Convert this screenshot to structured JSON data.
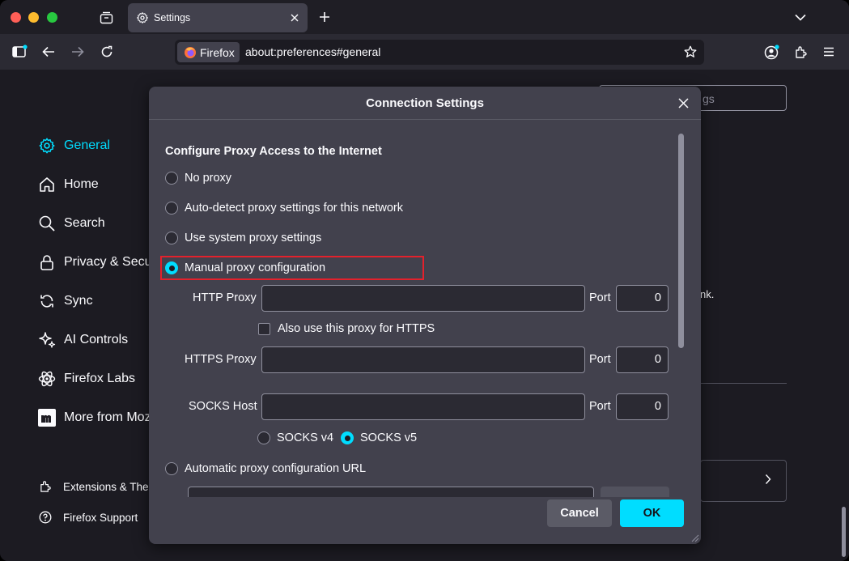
{
  "browser": {
    "tab_title": "Settings",
    "identity_label": "Firefox",
    "url": "about:preferences#general"
  },
  "sidebar": {
    "items": [
      {
        "label": "General",
        "icon": "gear-icon",
        "active": true
      },
      {
        "label": "Home",
        "icon": "home-icon"
      },
      {
        "label": "Search",
        "icon": "search-icon"
      },
      {
        "label": "Privacy & Secu",
        "icon": "lock-icon"
      },
      {
        "label": "Sync",
        "icon": "sync-icon"
      },
      {
        "label": "AI Controls",
        "icon": "sparkle-icon"
      },
      {
        "label": "Firefox Labs",
        "icon": "atom-icon"
      },
      {
        "label": "More from Moz",
        "icon": "mozilla-m-icon"
      }
    ],
    "footer": [
      {
        "label": "Extensions & The",
        "icon": "puzzle-icon"
      },
      {
        "label": "Firefox Support",
        "icon": "help-icon"
      }
    ]
  },
  "background": {
    "search_placeholder_fragment": "gs",
    "text_fragment": "nk."
  },
  "dialog": {
    "title": "Connection Settings",
    "section_title": "Configure Proxy Access to the Internet",
    "options": {
      "no_proxy": "No proxy",
      "auto_detect": "Auto-detect proxy settings for this network",
      "system": "Use system proxy settings",
      "manual": "Manual proxy configuration",
      "auto_url": "Automatic proxy configuration URL"
    },
    "selected_option": "manual",
    "http_proxy_label": "HTTP Proxy",
    "http_proxy_value": "",
    "http_port_label": "Port",
    "http_port_value": "0",
    "also_https_label": "Also use this proxy for HTTPS",
    "also_https_checked": false,
    "https_proxy_label": "HTTPS Proxy",
    "https_proxy_value": "",
    "https_port_label": "Port",
    "https_port_value": "0",
    "socks_host_label": "SOCKS Host",
    "socks_host_value": "",
    "socks_port_label": "Port",
    "socks_port_value": "0",
    "socks_v4_label": "SOCKS v4",
    "socks_v5_label": "SOCKS v5",
    "socks_version_selected": "v5",
    "cancel_label": "Cancel",
    "ok_label": "OK"
  },
  "colors": {
    "accent": "#00ddff",
    "highlight_border": "#e3212c",
    "dialog_bg": "#42414d",
    "page_bg": "#1c1b22"
  }
}
